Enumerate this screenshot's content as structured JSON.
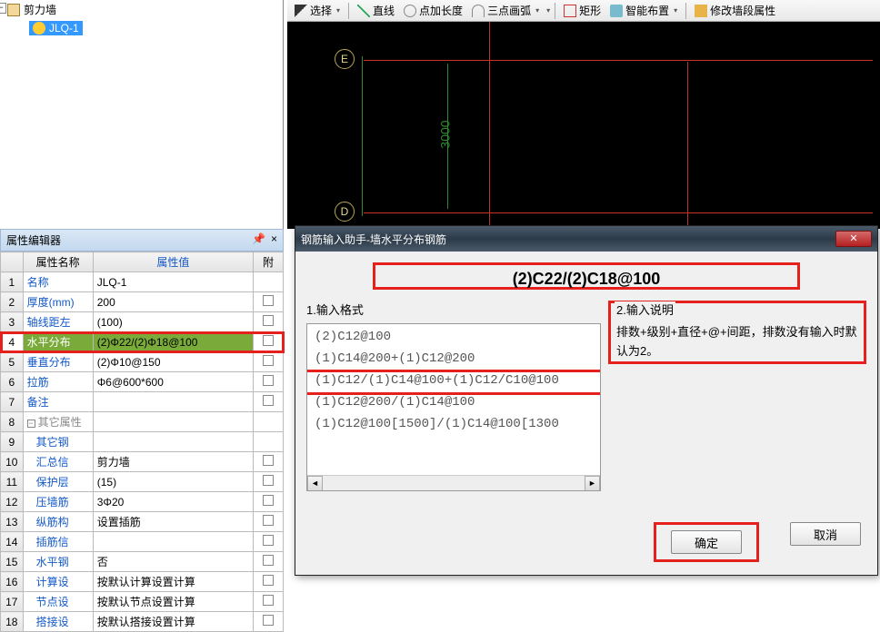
{
  "tree": {
    "root": "剪力墙",
    "child": "JLQ-1"
  },
  "toolbar": {
    "select": "选择",
    "line": "直线",
    "addlen": "点加长度",
    "arc3": "三点画弧",
    "rect": "矩形",
    "smart": "智能布置",
    "modify": "修改墙段属性"
  },
  "canvas": {
    "axisE": "E",
    "axisD": "D",
    "dim": "3000"
  },
  "prop": {
    "title": "属性编辑器",
    "headers": {
      "name": "属性名称",
      "value": "属性值",
      "attach": "附"
    },
    "rows": [
      {
        "n": "1",
        "name": "名称",
        "val": "JLQ-1",
        "chk": false,
        "gray": false
      },
      {
        "n": "2",
        "name": "厚度(mm)",
        "val": "200",
        "chk": true,
        "gray": false
      },
      {
        "n": "3",
        "name": "轴线距左",
        "val": "(100)",
        "chk": true,
        "gray": false
      },
      {
        "n": "4",
        "name": "水平分布",
        "val": "(2)Φ22/(2)Φ18@100",
        "chk": true,
        "sel": true,
        "gray": false
      },
      {
        "n": "5",
        "name": "垂直分布",
        "val": "(2)Φ10@150",
        "chk": true,
        "gray": false
      },
      {
        "n": "6",
        "name": "拉筋",
        "val": "Φ6@600*600",
        "chk": true,
        "gray": false
      },
      {
        "n": "7",
        "name": "备注",
        "val": "",
        "chk": true,
        "gray": false
      },
      {
        "n": "8",
        "name": "其它属性",
        "val": "",
        "chk": false,
        "gray": true,
        "group": true
      },
      {
        "n": "9",
        "name": "其它钢",
        "val": "",
        "chk": false,
        "gray": false
      },
      {
        "n": "10",
        "name": "汇总信",
        "val": "剪力墙",
        "chk": true,
        "gray": false
      },
      {
        "n": "11",
        "name": "保护层",
        "val": "(15)",
        "chk": true,
        "gray": false
      },
      {
        "n": "12",
        "name": "压墙筋",
        "val": "3Φ20",
        "chk": true,
        "gray": false
      },
      {
        "n": "13",
        "name": "纵筋构",
        "val": "设置插筋",
        "chk": true,
        "gray": false
      },
      {
        "n": "14",
        "name": "插筋信",
        "val": "",
        "chk": true,
        "gray": false
      },
      {
        "n": "15",
        "name": "水平钢",
        "val": "否",
        "chk": true,
        "gray": false
      },
      {
        "n": "16",
        "name": "计算设",
        "val": "按默认计算设置计算",
        "chk": true,
        "gray": false
      },
      {
        "n": "17",
        "name": "节点设",
        "val": "按默认节点设置计算",
        "chk": true,
        "gray": false
      },
      {
        "n": "18",
        "name": "搭接设",
        "val": "按默认搭接设置计算",
        "chk": true,
        "gray": false
      }
    ]
  },
  "dialog": {
    "title": "钢筋输入助手-墙水平分布钢筋",
    "formula": "(2)C22/(2)C18@100",
    "section1": "1.输入格式",
    "section2": "2.输入说明",
    "formats": [
      "(2)C12@100",
      "(1)C14@200+(1)C12@200",
      "(1)C12/(1)C14@100+(1)C12/C10@100",
      "(1)C12@200/(1)C14@100",
      "(1)C12@100[1500]/(1)C14@100[1300"
    ],
    "desc": "排数+级别+直径+@+间距，排数没有输入时默认为2。",
    "ok": "确定",
    "cancel": "取消",
    "close": "✕"
  }
}
